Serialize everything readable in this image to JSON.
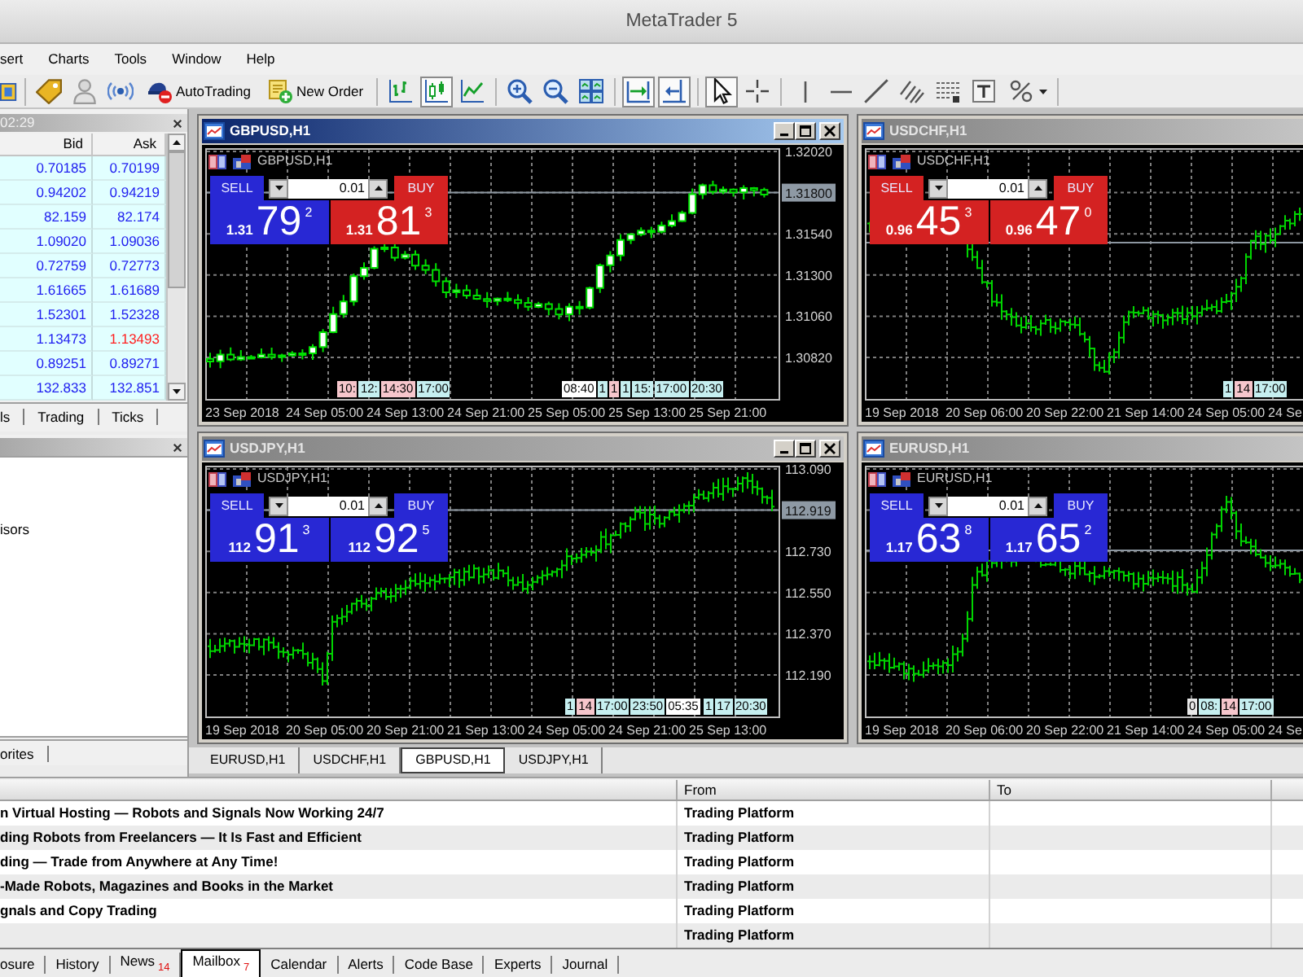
{
  "window": {
    "title": "MetaTrader 5"
  },
  "menu": [
    "sert",
    "Charts",
    "Tools",
    "Window",
    "Help"
  ],
  "toolbar": [
    {
      "kind": "terminal",
      "pressed": false
    },
    {
      "kind": "separator"
    },
    {
      "kind": "market",
      "pressed": false
    },
    {
      "kind": "person",
      "pressed": false
    },
    {
      "kind": "signal",
      "pressed": false
    },
    {
      "kind": "autotrading",
      "label": "AutoTrading",
      "pressed": false
    },
    {
      "kind": "new-order",
      "label": "New Order",
      "pressed": false
    },
    {
      "kind": "separator"
    },
    {
      "kind": "bar-chart",
      "pressed": false
    },
    {
      "kind": "candles",
      "pressed": true
    },
    {
      "kind": "line-chart",
      "pressed": false
    },
    {
      "kind": "separator"
    },
    {
      "kind": "zoom-in",
      "pressed": false
    },
    {
      "kind": "zoom-out",
      "pressed": false
    },
    {
      "kind": "tile",
      "pressed": false
    },
    {
      "kind": "separator"
    },
    {
      "kind": "chart-shift",
      "pressed": true
    },
    {
      "kind": "autoscroll",
      "pressed": true
    },
    {
      "kind": "separator"
    },
    {
      "kind": "cursor",
      "pressed": true
    },
    {
      "kind": "crosshair",
      "pressed": false
    },
    {
      "kind": "separator"
    },
    {
      "kind": "vline",
      "pressed": false
    },
    {
      "kind": "hline",
      "pressed": false
    },
    {
      "kind": "trendline",
      "pressed": false
    },
    {
      "kind": "fibo",
      "pressed": false
    },
    {
      "kind": "fibo-levels",
      "pressed": false
    },
    {
      "kind": "text",
      "pressed": false
    },
    {
      "kind": "shapes",
      "pressed": false
    },
    {
      "kind": "separator"
    }
  ],
  "market_watch": {
    "clock": "02:29",
    "columns": [
      "Bid",
      "Ask"
    ],
    "rows": [
      {
        "bid": {
          "text": "0.70185",
          "color": "#2020f0"
        },
        "ask": {
          "text": "0.70199",
          "color": "#2020f0"
        }
      },
      {
        "bid": {
          "text": "0.94202",
          "color": "#2020f0"
        },
        "ask": {
          "text": "0.94219",
          "color": "#2020f0"
        }
      },
      {
        "bid": {
          "text": "82.159",
          "color": "#2020f0"
        },
        "ask": {
          "text": "82.174",
          "color": "#2020f0"
        }
      },
      {
        "bid": {
          "text": "1.09020",
          "color": "#2020f0"
        },
        "ask": {
          "text": "1.09036",
          "color": "#2020f0"
        }
      },
      {
        "bid": {
          "text": "0.72759",
          "color": "#2020f0"
        },
        "ask": {
          "text": "0.72773",
          "color": "#2020f0"
        }
      },
      {
        "bid": {
          "text": "1.61665",
          "color": "#2020f0"
        },
        "ask": {
          "text": "1.61689",
          "color": "#2020f0"
        }
      },
      {
        "bid": {
          "text": "1.52301",
          "color": "#2020f0"
        },
        "ask": {
          "text": "1.52328",
          "color": "#2020f0"
        }
      },
      {
        "bid": {
          "text": "1.13473",
          "color": "#2020f0"
        },
        "ask": {
          "text": "1.13493",
          "color": "#ff2020"
        }
      },
      {
        "bid": {
          "text": "0.89251",
          "color": "#2020f0"
        },
        "ask": {
          "text": "0.89271",
          "color": "#2020f0"
        }
      },
      {
        "bid": {
          "text": "132.833",
          "color": "#2020f0"
        },
        "ask": {
          "text": "132.851",
          "color": "#2020f0"
        }
      }
    ],
    "tabs": [
      {
        "label": "ls",
        "selected": false
      },
      {
        "label": "Trading",
        "selected": false
      },
      {
        "label": "Ticks",
        "selected": false
      }
    ]
  },
  "navigator": {
    "items": [
      "isors"
    ],
    "tabs": [
      {
        "label": "orites",
        "selected": false
      }
    ]
  },
  "charts": [
    {
      "title": "GBPUSD,H1",
      "active": true,
      "window_buttons": true,
      "kind": "candles",
      "label": "GBPUSD,H1",
      "trade": {
        "sell": {
          "label": "SELL",
          "prefix": "1.31",
          "big": "79",
          "pip": "2",
          "color": "#2828d4"
        },
        "lot": "0.01",
        "buy": {
          "label": "BUY",
          "prefix": "1.31",
          "big": "81",
          "pip": "3",
          "color": "#d42222"
        }
      },
      "price_labels": [
        {
          "text": "1.32020",
          "current": false
        },
        {
          "text": "1.31800",
          "current": true
        },
        {
          "text": "1.31540",
          "current": false
        },
        {
          "text": "1.31300",
          "current": false
        },
        {
          "text": "1.31060",
          "current": false
        },
        {
          "text": "1.30820",
          "current": false
        }
      ],
      "time_labels": [
        "23 Sep 2018",
        "24 Sep 05:00",
        "24 Sep 13:00",
        "24 Sep 21:00",
        "25 Sep 05:00",
        "25 Sep 13:00",
        "25 Sep 21:00"
      ],
      "events": [
        [
          {
            "text": "10:",
            "color": "#f6c6cc"
          },
          {
            "text": "12:",
            "color": "#c6eff0"
          },
          {
            "text": "14:30",
            "color": "#f6c6cc"
          },
          {
            "text": "17:00",
            "color": "#c6eff0"
          }
        ],
        [
          {
            "text": "08:40",
            "color": "#ffffff"
          },
          {
            "text": "1",
            "color": "#c6eff0"
          },
          {
            "text": "1",
            "color": "#f6c6cc"
          },
          {
            "text": "1",
            "color": "#c6eff0"
          },
          {
            "text": "15:",
            "color": "#c6eff0"
          },
          {
            "text": "17:00",
            "color": "#c6eff0"
          },
          {
            "text": "20:30",
            "color": "#c6eff0"
          }
        ]
      ]
    },
    {
      "title": "USDCHF,H1",
      "active": false,
      "window_buttons": false,
      "kind": "bars",
      "label": "USDCHF,H1",
      "trade": {
        "sell": {
          "label": "SELL",
          "prefix": "0.96",
          "big": "45",
          "pip": "3",
          "color": "#d42222"
        },
        "lot": "0.01",
        "buy": {
          "label": "BUY",
          "prefix": "0.96",
          "big": "47",
          "pip": "0",
          "color": "#d42222"
        }
      },
      "time_labels": [
        "19 Sep 2018",
        "20 Sep 06:00",
        "20 Sep 22:00",
        "21 Sep 14:00",
        "24 Sep 05:00",
        "24 Se"
      ],
      "events": [
        [
          {
            "text": "1",
            "color": "#c6eff0"
          },
          {
            "text": "14",
            "color": "#f6c6cc"
          },
          {
            "text": "17:00",
            "color": "#c6eff0"
          }
        ]
      ]
    },
    {
      "title": "USDJPY,H1",
      "active": false,
      "window_buttons": true,
      "kind": "bars",
      "label": "USDJPY,H1",
      "trade": {
        "sell": {
          "label": "SELL",
          "prefix": "112",
          "big": "91",
          "pip": "3",
          "color": "#2828d4"
        },
        "lot": "0.01",
        "buy": {
          "label": "BUY",
          "prefix": "112",
          "big": "92",
          "pip": "5",
          "color": "#2828d4"
        }
      },
      "price_labels": [
        {
          "text": "113.090",
          "current": false
        },
        {
          "text": "112.919",
          "current": true
        },
        {
          "text": "112.730",
          "current": false
        },
        {
          "text": "112.550",
          "current": false
        },
        {
          "text": "112.370",
          "current": false
        },
        {
          "text": "112.190",
          "current": false
        }
      ],
      "time_labels": [
        "19 Sep 2018",
        "20 Sep 05:00",
        "20 Sep 21:00",
        "21 Sep 13:00",
        "24 Sep 05:00",
        "24 Sep 21:00",
        "25 Sep 13:00"
      ],
      "events": [
        [
          {
            "text": "1",
            "color": "#c6eff0"
          },
          {
            "text": "14",
            "color": "#f6c6cc"
          },
          {
            "text": "17:00",
            "color": "#c6eff0"
          },
          {
            "text": "23:50",
            "color": "#c6eff0"
          },
          {
            "text": "05:35",
            "color": "#ffffff"
          }
        ],
        [
          {
            "text": "1",
            "color": "#c6eff0"
          },
          {
            "text": "17",
            "color": "#c6eff0"
          },
          {
            "text": "20:30",
            "color": "#c6eff0"
          }
        ]
      ]
    },
    {
      "title": "EURUSD,H1",
      "active": false,
      "window_buttons": false,
      "kind": "bars",
      "label": "EURUSD,H1",
      "trade": {
        "sell": {
          "label": "SELL",
          "prefix": "1.17",
          "big": "63",
          "pip": "8",
          "color": "#2828d4"
        },
        "lot": "0.01",
        "buy": {
          "label": "BUY",
          "prefix": "1.17",
          "big": "65",
          "pip": "2",
          "color": "#2828d4"
        }
      },
      "time_labels": [
        "19 Sep 2018",
        "20 Sep 06:00",
        "20 Sep 22:00",
        "21 Sep 14:00",
        "24 Sep 05:00",
        "24 Se"
      ],
      "events": [
        [
          {
            "text": "0",
            "color": "#e8e8e8"
          },
          {
            "text": "08:",
            "color": "#c6eff0"
          },
          {
            "text": "14",
            "color": "#f6c6cc"
          },
          {
            "text": "17:00",
            "color": "#c6eff0"
          }
        ]
      ]
    }
  ],
  "chart_tabs": [
    {
      "label": "EURUSD,H1",
      "selected": false
    },
    {
      "label": "USDCHF,H1",
      "selected": false
    },
    {
      "label": "GBPUSD,H1",
      "selected": true
    },
    {
      "label": "USDJPY,H1",
      "selected": false
    }
  ],
  "toolbox": {
    "columns": [
      "From",
      "To"
    ],
    "rows": [
      {
        "subject": "n Virtual Hosting — Robots and Signals Now Working 24/7",
        "from": "Trading Platform",
        "unread": true
      },
      {
        "subject": "ding Robots from Freelancers — It Is Fast and Efficient",
        "from": "Trading Platform",
        "unread": true
      },
      {
        "subject": "ding — Trade from Anywhere at Any Time!",
        "from": "Trading Platform",
        "unread": true
      },
      {
        "subject": "-Made Robots, Magazines and Books in the Market",
        "from": "Trading Platform",
        "unread": true
      },
      {
        "subject": "gnals and Copy Trading",
        "from": "Trading Platform",
        "unread": true
      },
      {
        "from": "Trading Platform",
        "unread": true
      }
    ],
    "tabs": [
      {
        "label": "osure",
        "selected": false
      },
      {
        "label": "History",
        "selected": false
      },
      {
        "label": "News",
        "badge": "14",
        "selected": false
      },
      {
        "label": "Mailbox",
        "badge": "7",
        "selected": true
      },
      {
        "label": "Calendar",
        "selected": false
      },
      {
        "label": "Alerts",
        "selected": false
      },
      {
        "label": "Code Base",
        "selected": false
      },
      {
        "label": "Experts",
        "selected": false
      },
      {
        "label": "Journal",
        "selected": false
      }
    ]
  }
}
